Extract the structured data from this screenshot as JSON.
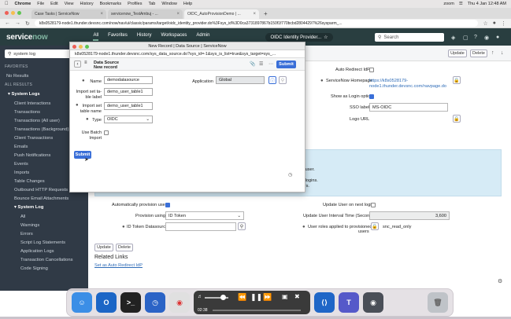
{
  "menubar": {
    "apple": "",
    "app": "Chrome",
    "items": [
      "File",
      "Edit",
      "View",
      "History",
      "Bookmarks",
      "Profiles",
      "Tab",
      "Window",
      "Help"
    ],
    "right": {
      "zoom": "zoom",
      "clock": "Thu 4 Jan 12:48 AM"
    }
  },
  "browser": {
    "tabs": [
      {
        "label": "Case Tasks | ServiceNow",
        "active": false
      },
      {
        "label": "servicenow_TestAmbuj - ...",
        "active": false
      },
      {
        "label": "OIDC_AutoProvisionDemo | ...",
        "active": true
      }
    ],
    "new_tab": "+",
    "url": "k8s0528179-node1.thunder.devsnc.com/now/nav/ui/classic/params/target/oidc_identity_provider.do%3Fsys_id%3D0ca3731897867b150f1f770bcbd28044297%26sysparm_..."
  },
  "header": {
    "logo_a": "service",
    "logo_b": "now",
    "nav": [
      {
        "label": "All",
        "active": true
      },
      {
        "label": "Favorites"
      },
      {
        "label": "History"
      },
      {
        "label": "Workspaces"
      },
      {
        "label": "Admin"
      }
    ],
    "context": "OIDC Identity Provider...",
    "search_placeholder": "Search"
  },
  "leftnav": {
    "filter": "system log",
    "favorites": "FAVORITES",
    "no_results": "No Results",
    "all_results": "ALL RESULTS",
    "group1": "System Logs",
    "items1": [
      "Client Interactions",
      "Transactions",
      "Transactions (All user)",
      "Transactions (Background)",
      "Client Transactions",
      "Emails",
      "Push Notifications",
      "Events",
      "Imports",
      "Table Changes",
      "Outbound HTTP Requests",
      "Bounce Email Attachments"
    ],
    "group2": "System Log",
    "items2": [
      "All",
      "Warnings",
      "Errors",
      "Script Log Statements",
      "Application Logs",
      "Transaction Cancellations",
      "Code Signing"
    ]
  },
  "form": {
    "update": "Update",
    "delete": "Delete",
    "auto_redirect_label": "Auto Redirect IdP",
    "homepage_label": "ServiceNow Homepage",
    "homepage_value": "https://k8s0528179-node1.thunder.devsnc.com/navpage.do",
    "show_login_label": "Show as Login option",
    "sso_label": "SSO label",
    "sso_value": "MS-OIDC",
    "logo_url_label": "Logo URL",
    "info_line1": "ceNow user.",
    "info_line2": "equent logins.",
    "info_line3": "ow users.",
    "auto_provision_label": "Automatically provision users",
    "update_on_login_label": "Update User on next login",
    "provision_using_label": "Provision using",
    "provision_using_value": "ID Token",
    "update_interval_label": "Update User Interval Time (Seconds)",
    "update_interval_value": "3,600",
    "id_token_ds_label": "ID Token Datasource",
    "user_roles_label1": "User roles applied to provisioned",
    "user_roles_label2": "users",
    "user_roles_value": "snc_read_only",
    "related_links": "Related Links",
    "set_auto_redirect": "Set as Auto Redirect IdP"
  },
  "modal": {
    "title": "New Record | Data Source | ServiceNow",
    "url": "k8s0528179-node1.thunder.devsnc.com/sys_data_source.do?sys_id=-1&sys_is_list=true&sys_target=sys_...",
    "header_line1": "Data Source",
    "header_line2": "New record",
    "submit": "Submit",
    "name_label": "Name",
    "name_value": "demodatasource",
    "application_label": "Application",
    "application_value": "Global",
    "import_label_label1": "Import set ta-",
    "import_label_label2": "ble label",
    "import_label_value": "demo_user_table1",
    "import_table_label1": "Import set",
    "import_table_label2": "table name",
    "import_table_value": "demo_user_table1",
    "type_label": "Type",
    "type_value": "OIDC",
    "batch_label1": "Use Batch",
    "batch_label2": "Import"
  },
  "dock": {
    "media_time_start": "02:38",
    "media_time_end": "-"
  }
}
